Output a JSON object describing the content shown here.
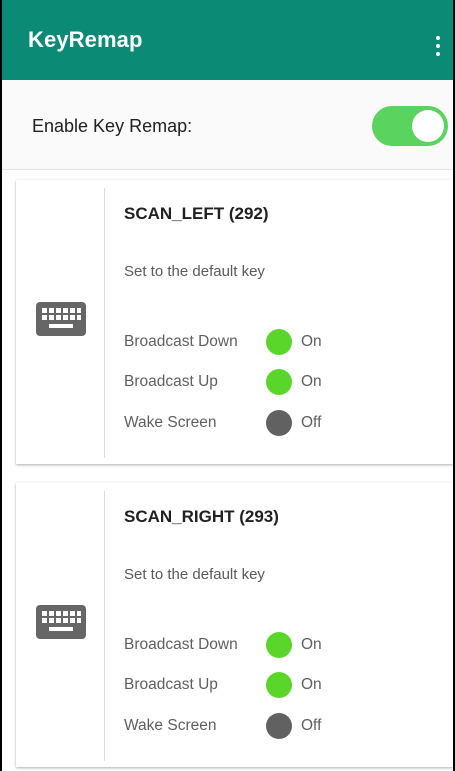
{
  "app": {
    "title": "KeyRemap"
  },
  "settings": {
    "enable_label": "Enable Key Remap:",
    "enabled": true
  },
  "colors": {
    "accent": "#0b8a75",
    "toggle_on": "#5ad35f",
    "status_on": "#5ad62a",
    "status_off": "#616161"
  },
  "keys": [
    {
      "name": "SCAN_LEFT (292)",
      "action": "Set to the default key",
      "options": [
        {
          "label": "Broadcast Down",
          "state": "On"
        },
        {
          "label": "Broadcast Up",
          "state": "On"
        },
        {
          "label": "Wake Screen",
          "state": "Off"
        }
      ]
    },
    {
      "name": "SCAN_RIGHT (293)",
      "action": "Set to the default key",
      "options": [
        {
          "label": "Broadcast Down",
          "state": "On"
        },
        {
          "label": "Broadcast Up",
          "state": "On"
        },
        {
          "label": "Wake Screen",
          "state": "Off"
        }
      ]
    }
  ]
}
